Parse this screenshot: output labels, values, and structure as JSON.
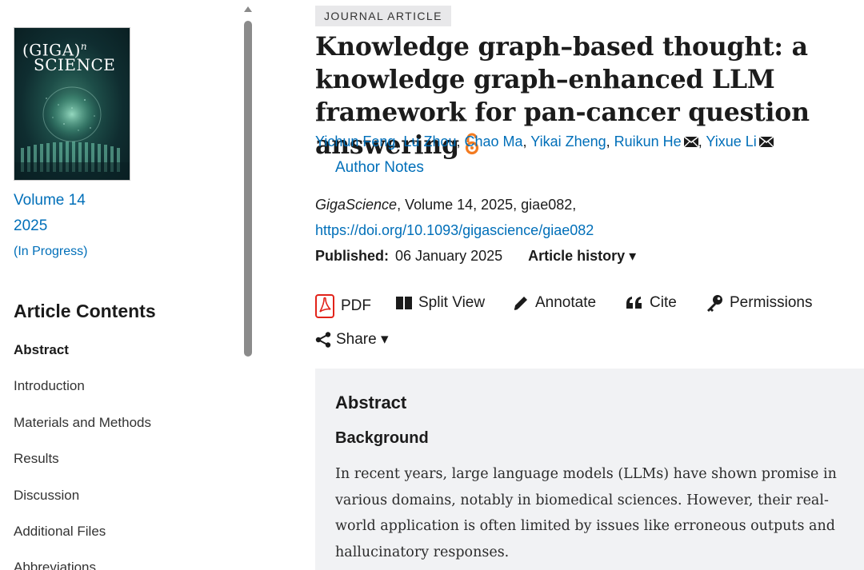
{
  "sidebar": {
    "cover": {
      "journal_line1": "(GIGA)",
      "journal_sup": "n",
      "journal_line2": "SCIENCE"
    },
    "volume": "Volume 14",
    "year": "2025",
    "status": "(In Progress)",
    "contents_heading": "Article Contents",
    "toc": [
      "Abstract",
      "Introduction",
      "Materials and Methods",
      "Results",
      "Discussion",
      "Additional Files",
      "Abbreviations"
    ]
  },
  "article": {
    "type_badge": "JOURNAL ARTICLE",
    "title": "Knowledge graph–based thought: a knowledge graph–enhanced LLM framework for pan-cancer question answering",
    "authors": [
      "Yichun Feng",
      "Lu Zhou",
      "Chao Ma",
      "Yikai Zheng",
      "Ruikun He",
      "Yixue Li"
    ],
    "author_separator": ", ",
    "author_notes": "Author Notes",
    "journal": "GigaScience",
    "citation_rest": ", Volume 14, 2025, giae082,",
    "doi": "https://doi.org/10.1093/gigascience/giae082",
    "published_label": "Published:",
    "published_date": "06 January 2025",
    "history_label": "Article history ▾"
  },
  "toolbar": {
    "pdf": "PDF",
    "split_view": "Split View",
    "annotate": "Annotate",
    "cite": "Cite",
    "permissions": "Permissions",
    "share": "Share ▾"
  },
  "abstract": {
    "heading": "Abstract",
    "subheading": "Background",
    "text": "In recent years, large language models (LLMs) have shown promise in various domains, notably in biomedical sciences. However, their real-world application is often limited by issues like erroneous outputs and hallucinatory responses."
  },
  "colors": {
    "link": "#006fb9",
    "open_access": "#f37b21",
    "pdf_red": "#e2231a",
    "abstract_bg": "#f1f2f4"
  },
  "icons": [
    "open-access-icon",
    "mail-icon",
    "pdf-icon",
    "split-view-icon",
    "pencil-icon",
    "quote-icon",
    "key-icon",
    "share-icon",
    "chevron-down-icon"
  ]
}
